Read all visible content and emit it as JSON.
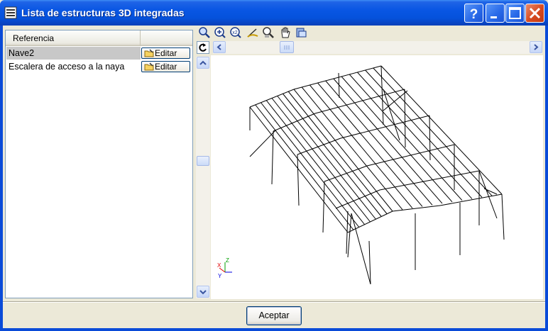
{
  "window": {
    "title": "Lista de estructuras 3D integradas",
    "colors": {
      "titlebar": "#0956e3",
      "close": "#d6491f",
      "face": "#ece9d8"
    }
  },
  "list": {
    "header": "Referencia",
    "items": [
      {
        "label": "Nave2",
        "button": "Editar",
        "selected": true
      },
      {
        "label": "Escalera de acceso a la naya",
        "button": "Editar",
        "selected": false
      }
    ]
  },
  "toolbar": {
    "icons": [
      "zoom-extents-icon",
      "zoom-window-icon",
      "zoom-x2-icon",
      "rotate-view-icon",
      "zoom-out-icon",
      "pan-hand-icon",
      "print-view-icon"
    ]
  },
  "axes": {
    "x": "X",
    "y": "Y",
    "z": "Z"
  },
  "footer": {
    "accept_label": "Aceptar"
  }
}
